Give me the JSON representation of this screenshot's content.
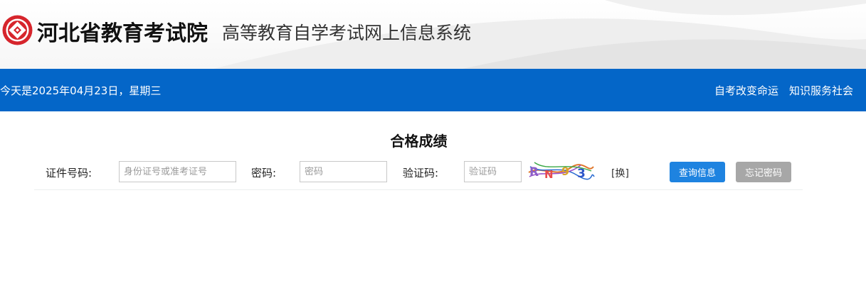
{
  "header": {
    "org_name": "河北省教育考试院",
    "system_name": "高等教育自学考试网上信息系统",
    "logo_icon": "hebei-exam-authority-seal"
  },
  "bluebar": {
    "date_text": "今天是2025年04月23日，星期三",
    "slogans": [
      "自考改变命运",
      "知识服务社会"
    ],
    "color": "#0466c8"
  },
  "main": {
    "title": "合格成绩",
    "form": {
      "id_label": "证件号码:",
      "id_placeholder": "身份证号或准考证号",
      "password_label": "密码:",
      "password_placeholder": "密码",
      "captcha_label": "验证码:",
      "captcha_placeholder": "验证码",
      "swap_text": "[换]",
      "query_button": "查询信息",
      "forgot_button": "忘记密码"
    }
  },
  "colors": {
    "query_button": "#1e83e0",
    "forgot_button": "#a7a7a7"
  }
}
